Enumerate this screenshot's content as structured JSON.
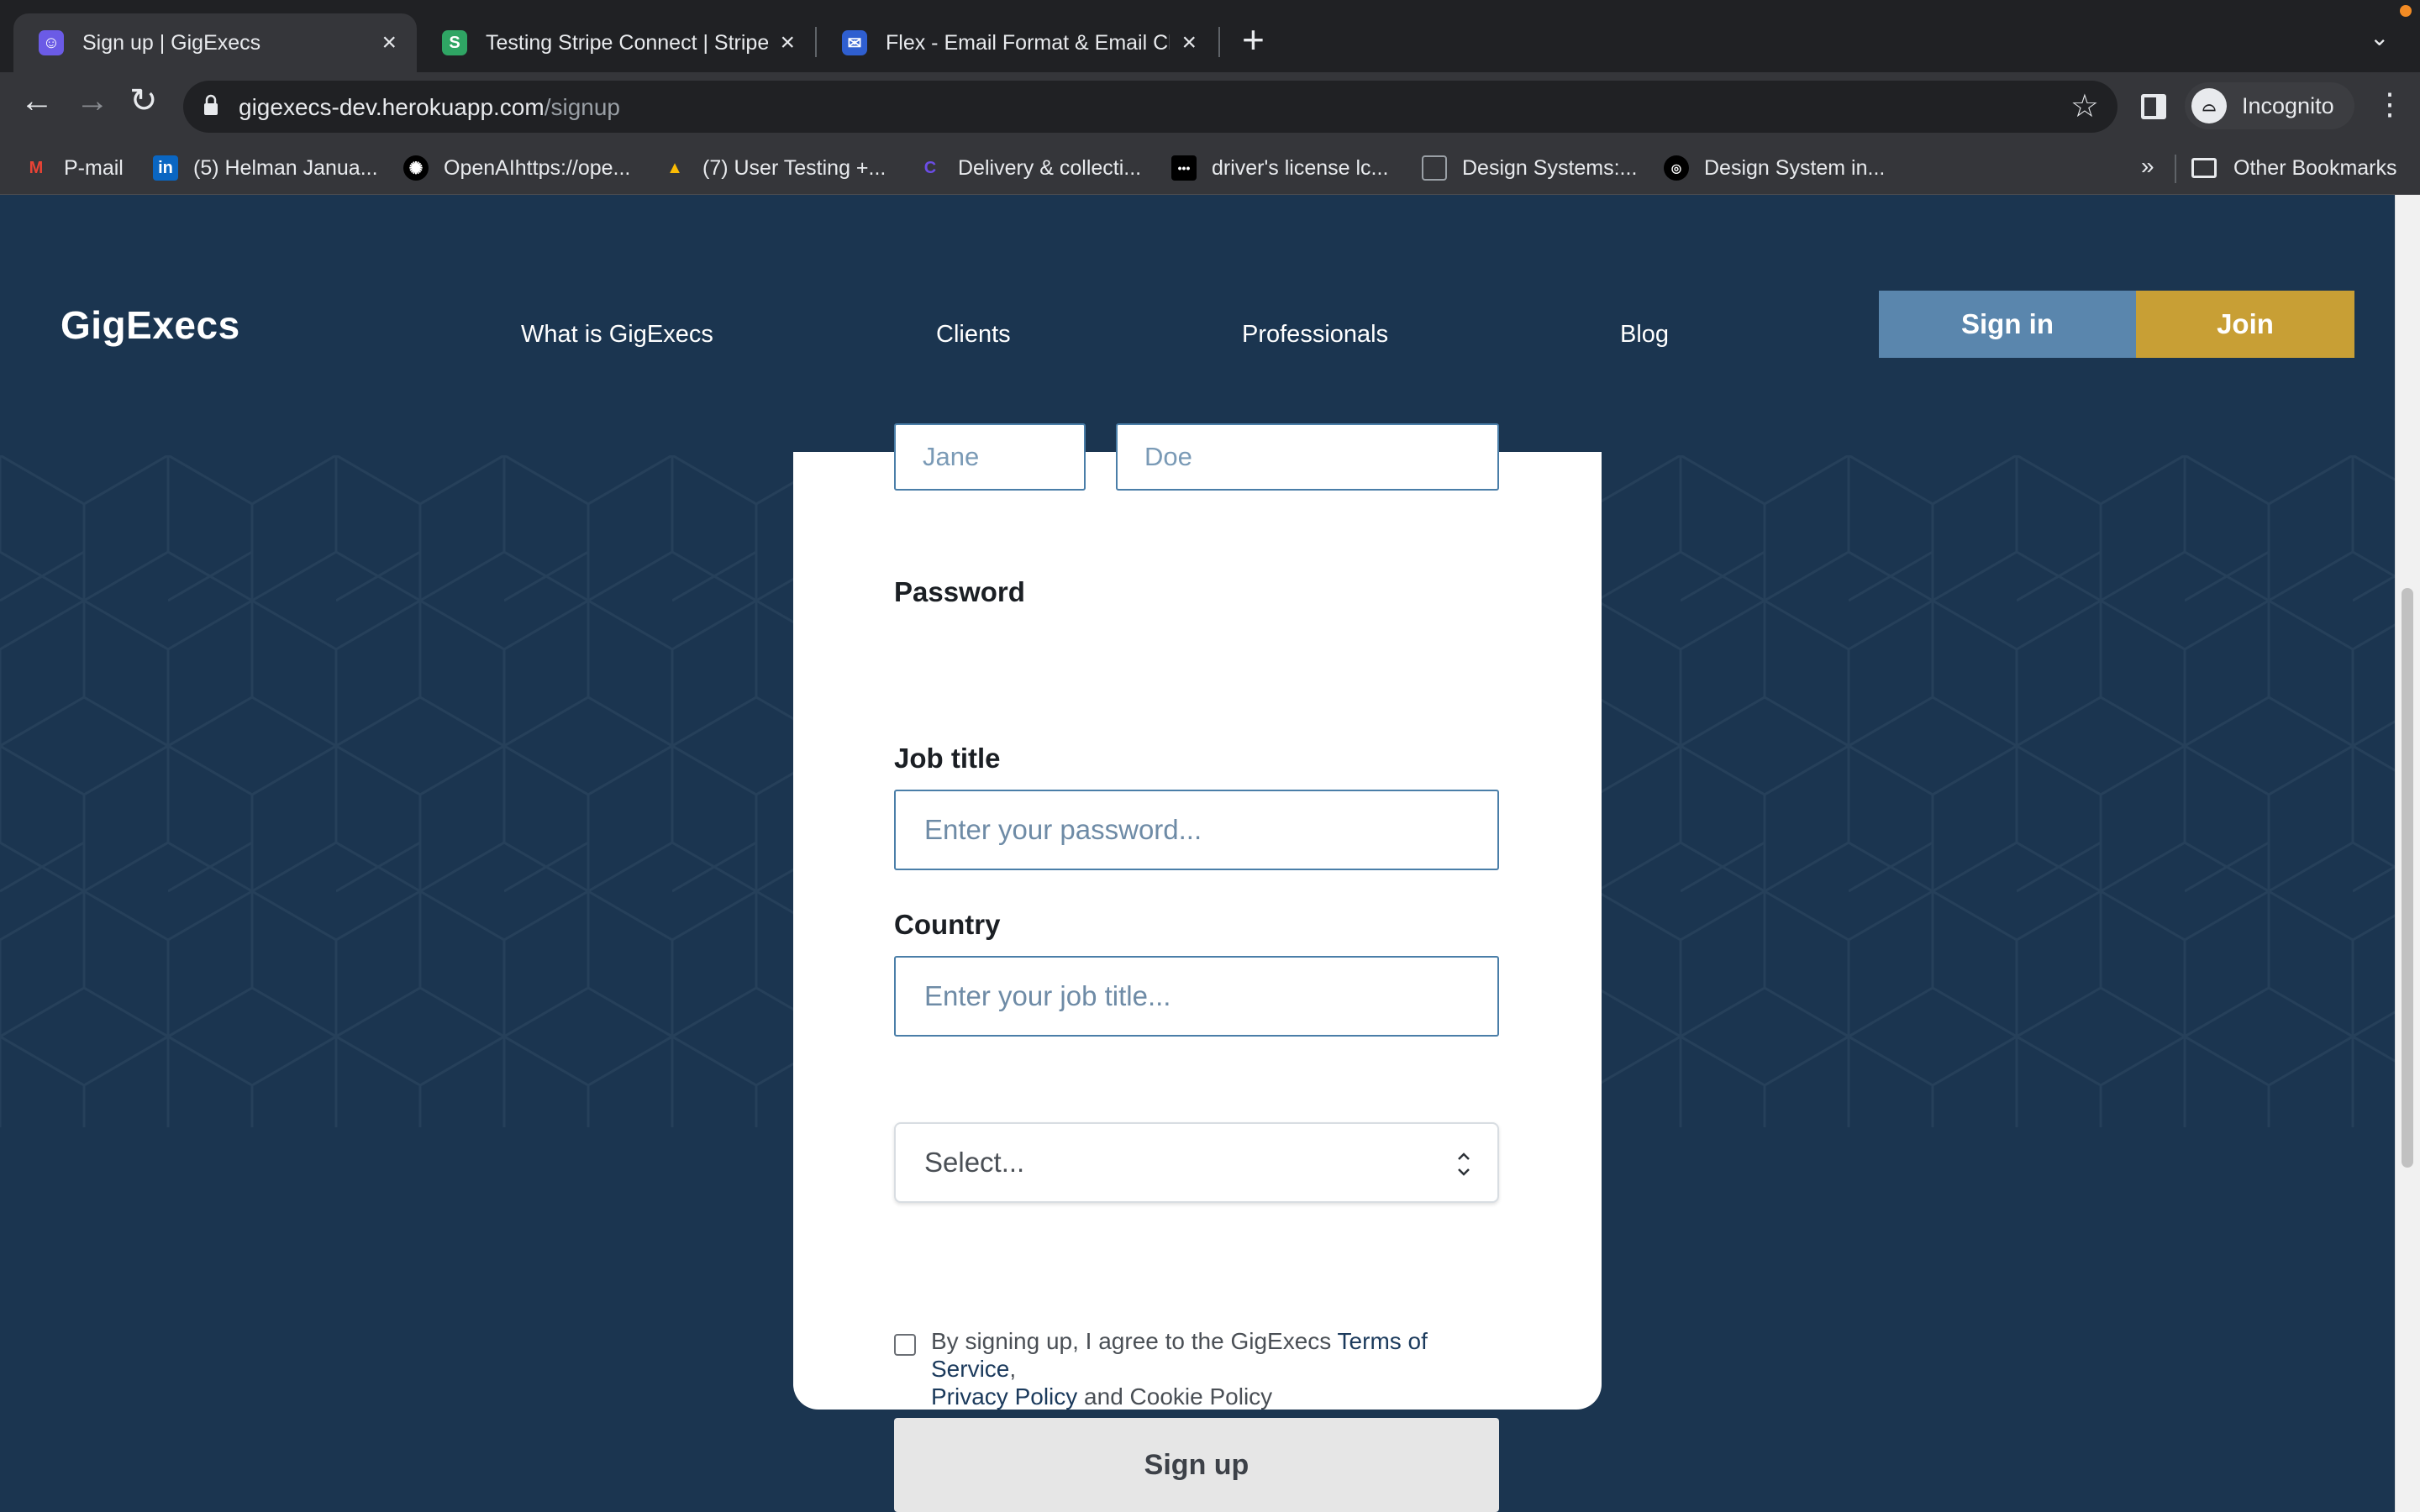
{
  "browser": {
    "tabs": [
      {
        "title": "Sign up | GigExecs",
        "active": true
      },
      {
        "title": "Testing Stripe Connect | Stripe",
        "active": false
      },
      {
        "title": "Flex - Email Format & Email Ch",
        "active": false
      }
    ],
    "url_host": "gigexecs-dev.herokuapp.com",
    "url_path": "/signup",
    "profile_label": "Incognito",
    "bookmarks": [
      {
        "label": "P-mail"
      },
      {
        "label": "(5) Helman Janua..."
      },
      {
        "label": "OpenAIhttps://ope..."
      },
      {
        "label": "(7) User Testing +..."
      },
      {
        "label": "Delivery & collecti..."
      },
      {
        "label": "driver's license lc..."
      },
      {
        "label": "Design Systems:..."
      },
      {
        "label": "Design System in..."
      }
    ],
    "bookmarks_more": "»",
    "other_bookmarks": "Other Bookmarks"
  },
  "site": {
    "logo": "GigExecs",
    "nav": [
      "What is GigExecs",
      "Clients",
      "Professionals",
      "Blog"
    ],
    "signin_label": "Sign in",
    "join_label": "Join",
    "colors": {
      "background": "#1b3550",
      "signin": "#5a86ad",
      "join": "#c89f35"
    }
  },
  "form": {
    "first_name_placeholder": "Jane",
    "last_name_placeholder": "Doe",
    "password_label": "Password",
    "password_placeholder": "Enter your password...",
    "job_title_label": "Job title",
    "job_title_placeholder": "Enter your job title...",
    "country_label": "Country",
    "country_value": "Select...",
    "terms_prefix": "By signing up, I agree to the GigExecs ",
    "terms_link": "Terms of Service",
    "terms_comma": ",",
    "privacy_link": "Privacy Policy",
    "terms_suffix": " and Cookie Policy",
    "signup_label": "Sign up"
  }
}
